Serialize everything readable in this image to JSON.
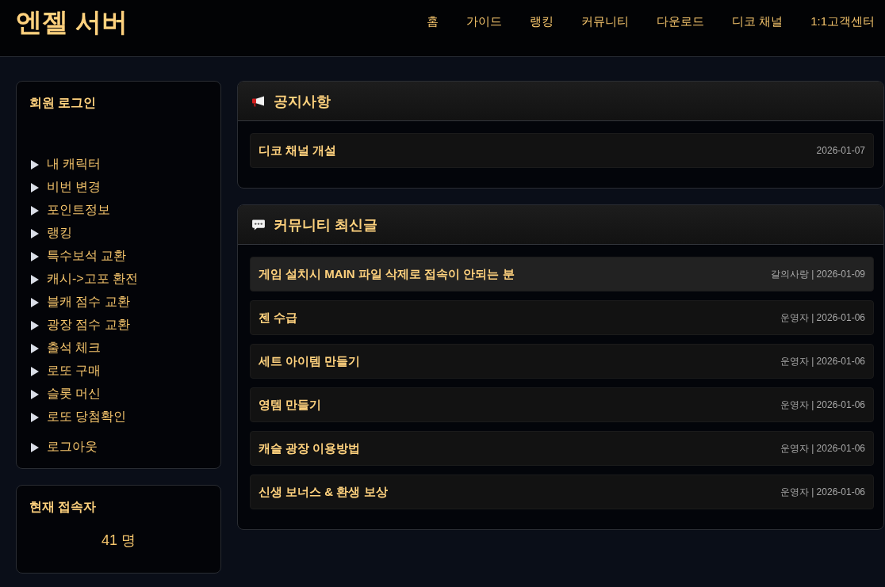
{
  "header": {
    "logo": "엔젤 서버",
    "nav": [
      "홈",
      "가이드",
      "랭킹",
      "커뮤니티",
      "다운로드",
      "디코 채널",
      "1:1고객센터"
    ]
  },
  "sidebar": {
    "login_panel": {
      "title": "회원 로그인",
      "menu": [
        "내 캐릭터",
        "비번 변경",
        "포인트정보",
        "랭킹",
        "특수보석 교환",
        "캐시->고포 환전",
        "블캐 점수 교환",
        "광장 점수 교환",
        "출석 체크",
        "로또 구매",
        "슬롯 머신",
        "로또 당첨확인"
      ],
      "logout": "로그아웃"
    },
    "online_panel": {
      "title": "현재 접속자",
      "count": "41 명"
    }
  },
  "notice": {
    "title": "공지사항",
    "posts": [
      {
        "title": "디코 채널 개설",
        "meta": "2026-01-07",
        "highlighted": false
      }
    ]
  },
  "community": {
    "title": "커뮤니티 최신글",
    "posts": [
      {
        "title": "게임 설치시 MAIN 파일 삭제로 접속이 안되는 분",
        "meta": "갈의사랑 | 2026-01-09",
        "highlighted": true
      },
      {
        "title": "젠 수급",
        "meta": "운영자 | 2026-01-06",
        "highlighted": false
      },
      {
        "title": "세트 아이템 만들기",
        "meta": "운영자 | 2026-01-06",
        "highlighted": false
      },
      {
        "title": "영템 만들기",
        "meta": "운영자 | 2026-01-06",
        "highlighted": false
      },
      {
        "title": "캐슬 광장 이용방법",
        "meta": "운영자 | 2026-01-06",
        "highlighted": false
      },
      {
        "title": "신생 보너스 & 환생 보상",
        "meta": "운영자 | 2026-01-06",
        "highlighted": false
      }
    ]
  }
}
